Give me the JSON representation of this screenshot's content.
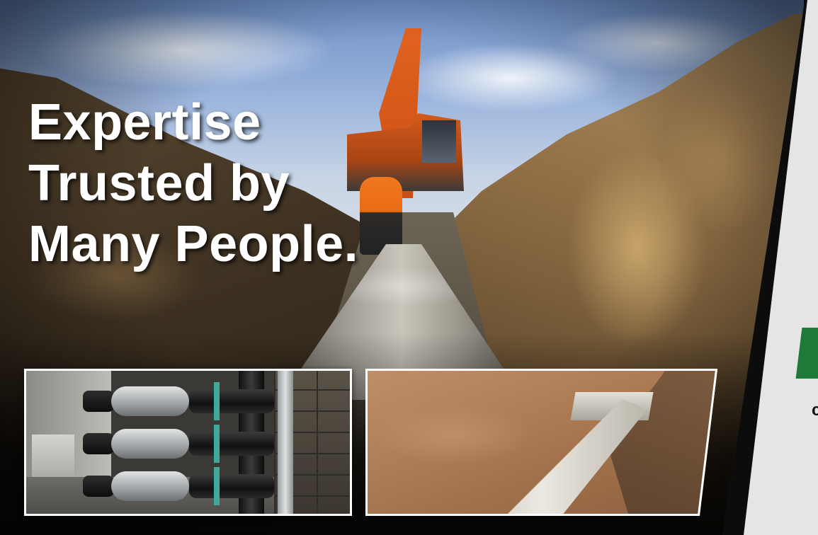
{
  "hero": {
    "headline_lines": [
      "Expertise",
      "Trusted by",
      "Many People."
    ]
  },
  "thumbnails": [
    {
      "subject": "pump room with valve assemblies"
    },
    {
      "subject": "concrete culvert pipe in excavated trench"
    }
  ],
  "side_panel": {
    "accent_color": "#1f7a3a",
    "partial_text": "c"
  },
  "colors": {
    "headline_text": "#ffffff",
    "frame_border": "#ffffff",
    "background": "#0c0c0c",
    "panel": "#e5e5e5"
  }
}
